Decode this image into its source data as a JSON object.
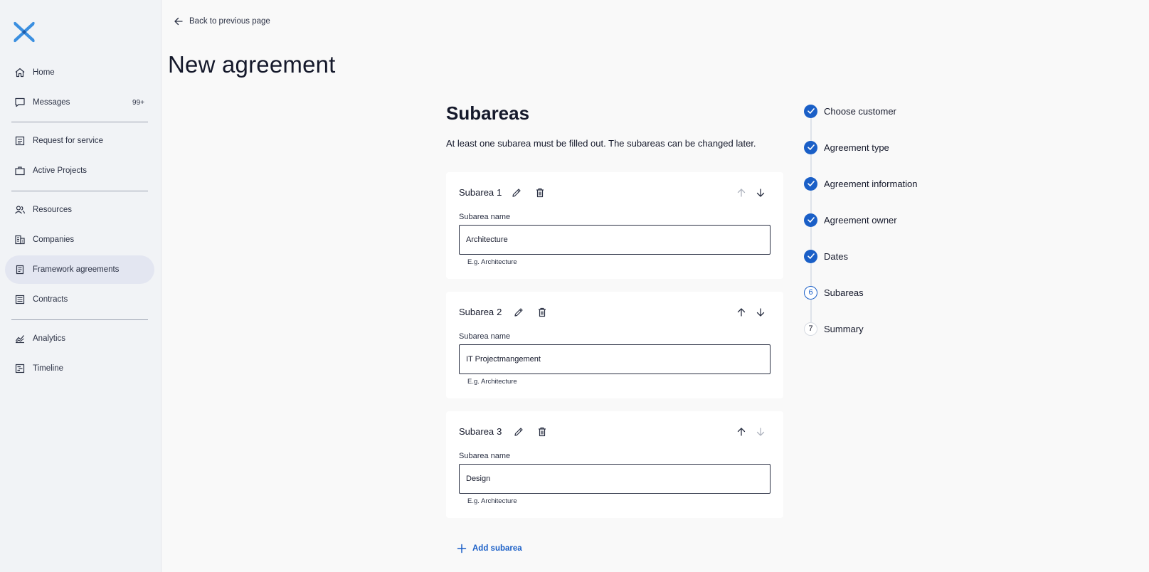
{
  "colors": {
    "accent": "#1a5fc7",
    "sidebar_bg": "#f1f3f6",
    "active_item_bg": "#e3e6f1",
    "logo": "#3b8fe0"
  },
  "sidebar": {
    "items": [
      {
        "label": "Home",
        "icon": "home-icon"
      },
      {
        "label": "Messages",
        "icon": "message-icon",
        "badge": "99+"
      },
      {
        "label": "Request for service",
        "icon": "request-icon"
      },
      {
        "label": "Active Projects",
        "icon": "briefcase-icon"
      },
      {
        "label": "Resources",
        "icon": "users-icon"
      },
      {
        "label": "Companies",
        "icon": "building-icon"
      },
      {
        "label": "Framework agreements",
        "icon": "document-icon",
        "active": true
      },
      {
        "label": "Contracts",
        "icon": "list-icon"
      },
      {
        "label": "Analytics",
        "icon": "chart-icon"
      },
      {
        "label": "Timeline",
        "icon": "timeline-icon"
      }
    ]
  },
  "header": {
    "back_label": "Back to previous page",
    "title": "New agreement"
  },
  "section": {
    "title": "Subareas",
    "description": "At least one subarea must be filled out. The subareas can be changed later."
  },
  "subareas": [
    {
      "title": "Subarea",
      "number": "1",
      "field_label": "Subarea name",
      "value": "Architecture",
      "hint": "E.g. Architecture",
      "up_enabled": false,
      "down_enabled": true
    },
    {
      "title": "Subarea",
      "number": "2",
      "field_label": "Subarea name",
      "value": "IT Projectmangement",
      "hint": "E.g. Architecture",
      "up_enabled": true,
      "down_enabled": true
    },
    {
      "title": "Subarea",
      "number": "3",
      "field_label": "Subarea name",
      "value": "Design",
      "hint": "E.g. Architecture",
      "up_enabled": true,
      "down_enabled": false
    }
  ],
  "add_subarea_label": "Add subarea",
  "steps": [
    {
      "label": "Choose customer",
      "status": "done"
    },
    {
      "label": "Agreement type",
      "status": "done"
    },
    {
      "label": "Agreement information",
      "status": "done"
    },
    {
      "label": "Agreement owner",
      "status": "done"
    },
    {
      "label": "Dates",
      "status": "done"
    },
    {
      "label": "Subareas",
      "status": "current",
      "number": "6"
    },
    {
      "label": "Summary",
      "status": "todo",
      "number": "7"
    }
  ]
}
